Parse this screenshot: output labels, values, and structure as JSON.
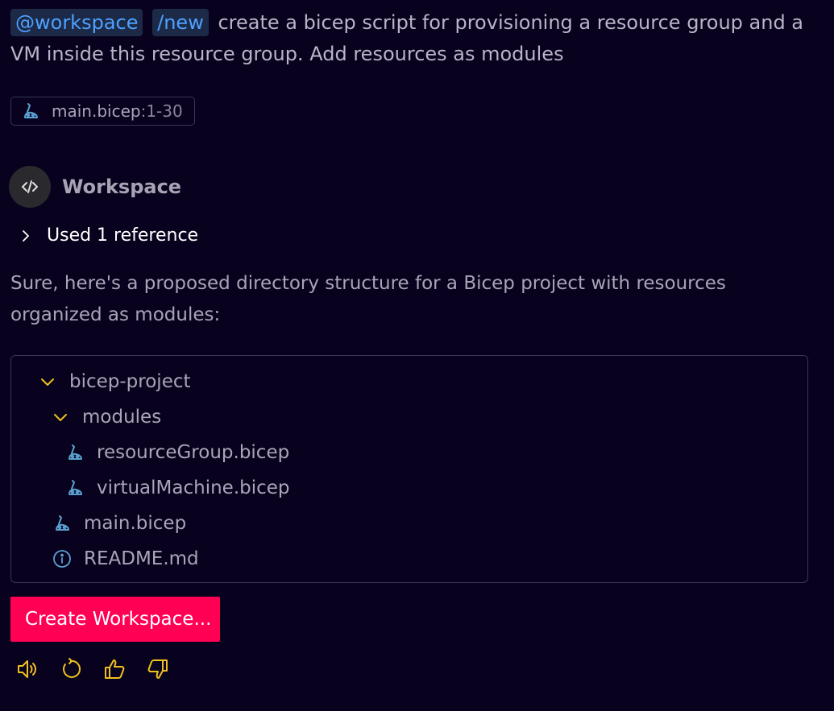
{
  "prompt": {
    "agent_chip": "@workspace",
    "command_chip": "/new",
    "text": "create a bicep script for provisioning a resource group and a VM inside this resource group. Add resources as modules"
  },
  "reference_pill": {
    "file": "main.bicep",
    "range": ":1-30"
  },
  "response": {
    "agent_name": "Workspace",
    "used_references": "Used 1 reference",
    "answer": "Sure, here's a proposed directory structure for a Bicep project with resources organized as modules:",
    "tree": {
      "root": "bicep-project",
      "modules_folder": "modules",
      "module_files": [
        "resourceGroup.bicep",
        "virtualMachine.bicep"
      ],
      "main_file": "main.bicep",
      "readme_file": "README.md"
    },
    "create_button": "Create Workspace..."
  },
  "colors": {
    "background": "#08021e",
    "accent": "#ff0055",
    "chip_text": "#4ea1ff",
    "icon_yellow": "#f0c020",
    "bicep_icon": "#5aa0d0"
  },
  "icons": {
    "avatar": "code-brackets-icon",
    "expand": "chevron-right-icon",
    "folder_open": "chevron-down-icon",
    "bicep_file": "bicep-icon",
    "readme_file": "info-icon",
    "actions": [
      "speaker-icon",
      "retry-icon",
      "thumbs-up-icon",
      "thumbs-down-icon"
    ]
  }
}
